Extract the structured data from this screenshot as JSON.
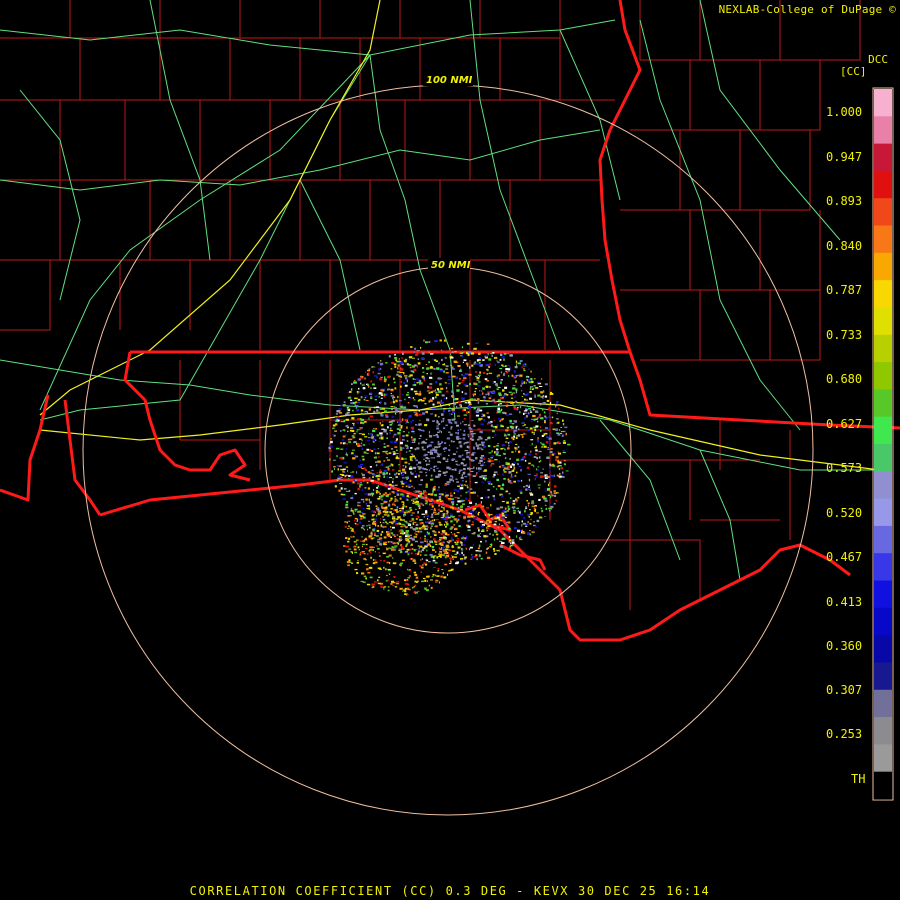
{
  "header": {
    "credit": "NEXLAB-College of DuPage ©",
    "site_code": "DCC",
    "unit": "[CC]"
  },
  "footer": {
    "caption": "CORRELATION COEFFICIENT (CC) 0.3 DEG - KEVX 30 DEC 25 16:14"
  },
  "range_rings": [
    {
      "label": "50 NMI"
    },
    {
      "label": "100 NMI"
    }
  ],
  "color_scale": {
    "labels": [
      "1.000",
      "0.947",
      "0.893",
      "0.840",
      "0.787",
      "0.733",
      "0.680",
      "0.627",
      "0.573",
      "0.520",
      "0.467",
      "0.413",
      "0.360",
      "0.307",
      "0.253",
      "TH"
    ],
    "colors": [
      "#f7b0d0",
      "#e880a8",
      "#c81838",
      "#e01010",
      "#f04818",
      "#f87818",
      "#f8a800",
      "#f8d800",
      "#e0e000",
      "#b8d000",
      "#90c800",
      "#58c828",
      "#40e850",
      "#48c868",
      "#9090d0",
      "#9898e8",
      "#6868e0",
      "#3838e8",
      "#1010e0",
      "#0808c8",
      "#0808a8",
      "#181890",
      "#707098",
      "#8c8c90",
      "#9a9a9a",
      "#000000"
    ]
  },
  "colors": {
    "state_boundary": "#ff1a1a",
    "county_boundary": "#c01818",
    "highway": "#60e080",
    "interstate": "#f0f020",
    "range_ring": "#f0c0a0",
    "text": "#f2f200"
  }
}
